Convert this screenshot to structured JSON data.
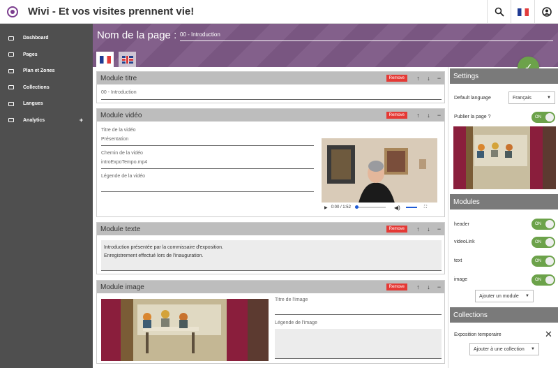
{
  "app": {
    "title": "Wivi - Et vos visites prennent vie!"
  },
  "topbar": {
    "search_icon": "search-icon",
    "language_flag": "fr-flag-icon",
    "account_icon": "account-icon"
  },
  "sidebar": {
    "items": [
      {
        "label": "Dashboard",
        "icon": "dashboard-icon"
      },
      {
        "label": "Pages",
        "icon": "pages-icon"
      },
      {
        "label": "Plan et Zones",
        "icon": "map-icon"
      },
      {
        "label": "Collections",
        "icon": "list-icon"
      },
      {
        "label": "Langues",
        "icon": "translate-icon"
      },
      {
        "label": "Analytics",
        "icon": "analytics-icon",
        "expand": "+"
      }
    ]
  },
  "page": {
    "name_label": "Nom de la page :",
    "name_value": "00 - Introduction",
    "tabs": [
      "fr",
      "en"
    ]
  },
  "modules": [
    {
      "title": "Module titre",
      "remove": "Remove",
      "value": "00 - Introduction"
    },
    {
      "title": "Module vidéo",
      "remove": "Remove",
      "title_label": "Titre de la vidéo",
      "title_value": "Présentation",
      "path_label": "Chemin de la vidéo",
      "path_value": "introExpoTempo.mp4",
      "caption_label": "Légende de la vidéo",
      "caption_value": "",
      "player_time": "0:00 / 1:52"
    },
    {
      "title": "Module texte",
      "remove": "Remove",
      "text_line1": "Introduction présentée par la commissaire d'exposition.",
      "text_line2": "Enregistrement effectué lors de l'inauguration."
    },
    {
      "title": "Module image",
      "remove": "Remove",
      "image_title_label": "Titre de l'image",
      "image_caption_label": "Légende de l'image"
    }
  ],
  "settings": {
    "title": "Settings",
    "default_language_label": "Default language",
    "default_language_value": "Français",
    "publish_label": "Publier la page ?",
    "publish_value": "ON"
  },
  "modules_panel": {
    "title": "Modules",
    "items": [
      {
        "label": "header",
        "toggle": "ON"
      },
      {
        "label": "videoLink",
        "toggle": "ON"
      },
      {
        "label": "text",
        "toggle": "ON"
      },
      {
        "label": "image",
        "toggle": "ON"
      }
    ],
    "add_button": "Ajouter un module"
  },
  "collections_panel": {
    "title": "Collections",
    "item": "Exposition temporaire",
    "add_button": "Ajouter à une collection"
  },
  "colors": {
    "header_purple": "#7e5a86",
    "sidebar": "#4f4f4f",
    "accent_green": "#6ca24a",
    "remove_red": "#e53935"
  }
}
